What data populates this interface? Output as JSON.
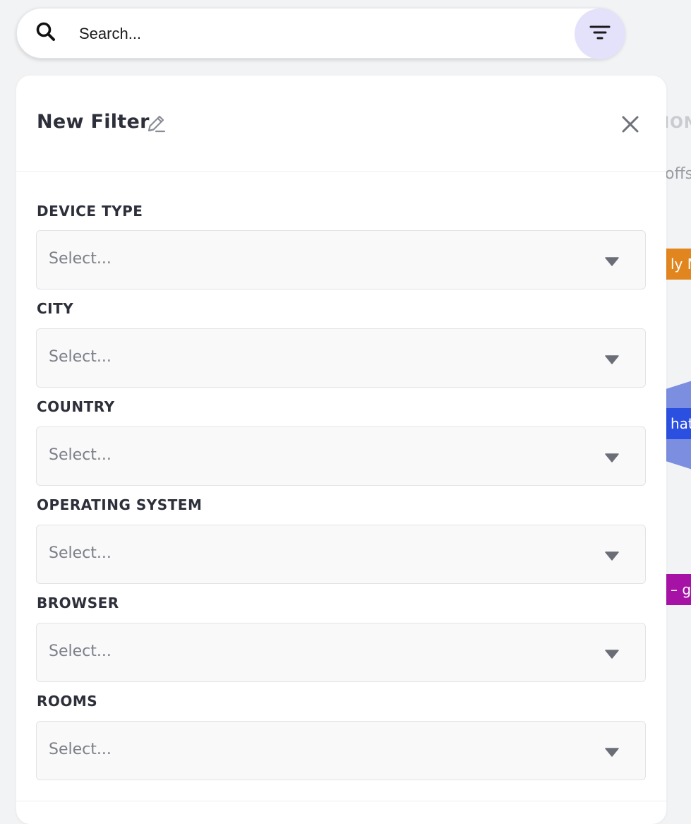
{
  "search": {
    "placeholder": "Search..."
  },
  "background": {
    "heading_fragment": "ION",
    "sub_fragment": "offs",
    "tag_orange": "ly M",
    "tag_blue": "hat",
    "tag_purple": "– g"
  },
  "panel": {
    "title": "New Filter",
    "fields": [
      {
        "label": "DEVICE TYPE",
        "placeholder": "Select..."
      },
      {
        "label": "CITY",
        "placeholder": "Select..."
      },
      {
        "label": "COUNTRY",
        "placeholder": "Select..."
      },
      {
        "label": "OPERATING SYSTEM",
        "placeholder": "Select..."
      },
      {
        "label": "BROWSER",
        "placeholder": "Select..."
      },
      {
        "label": "ROOMS",
        "placeholder": "Select..."
      }
    ]
  },
  "colors": {
    "accent_soft": "#e4e1fb",
    "tag_orange": "#e1861f",
    "tag_blue": "#2b4fe0",
    "tag_purple": "#a712a6"
  },
  "icons": {
    "search": "search-icon",
    "filter": "filter-icon",
    "edit": "pencil-icon",
    "close": "close-icon",
    "dropdown": "chevron-down-icon"
  }
}
